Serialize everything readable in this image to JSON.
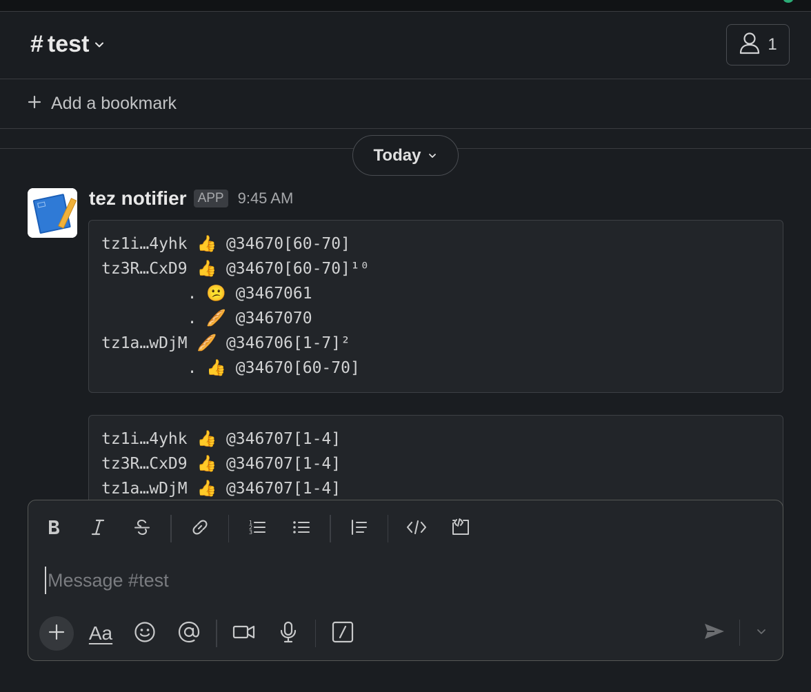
{
  "channel": {
    "hash": "#",
    "name": "test",
    "member_count": "1"
  },
  "bookmarks": {
    "add_label": "Add a bookmark"
  },
  "divider": {
    "label": "Today"
  },
  "message": {
    "sender": "tez notifier",
    "badge": "APP",
    "time": "9:45 AM",
    "block1": [
      "tz1i…4yhk 👍 @34670[60-70]",
      "tz3R…CxD9 👍 @34670[60-70]¹⁰",
      "         . 😕 @3467061",
      "         . 🥖 @3467070",
      "tz1a…wDjM 🥖 @346706[1-7]²",
      "         . 👍 @34670[60-70]"
    ],
    "block2": [
      "tz1i…4yhk 👍 @346707[1-4]",
      "tz3R…CxD9 👍 @346707[1-4]",
      "tz1a…wDjM 👍 @346707[1-4]"
    ]
  },
  "composer": {
    "placeholder": "Message #test",
    "format_label": "Aa"
  },
  "icons": {
    "bold": "bold-icon",
    "italic": "italic-icon",
    "strike": "strikethrough-icon",
    "link": "link-icon",
    "ordered": "ordered-list-icon",
    "bullet": "bulleted-list-icon",
    "quote": "blockquote-icon",
    "code": "code-icon",
    "codeblock": "code-block-icon",
    "plus": "plus-icon",
    "emoji": "emoji-icon",
    "mention": "mention-icon",
    "video": "video-icon",
    "mic": "microphone-icon",
    "shortcut": "slash-command-icon",
    "send": "send-icon"
  },
  "colors": {
    "background": "#1a1d21",
    "accent_green": "#2bac76"
  }
}
